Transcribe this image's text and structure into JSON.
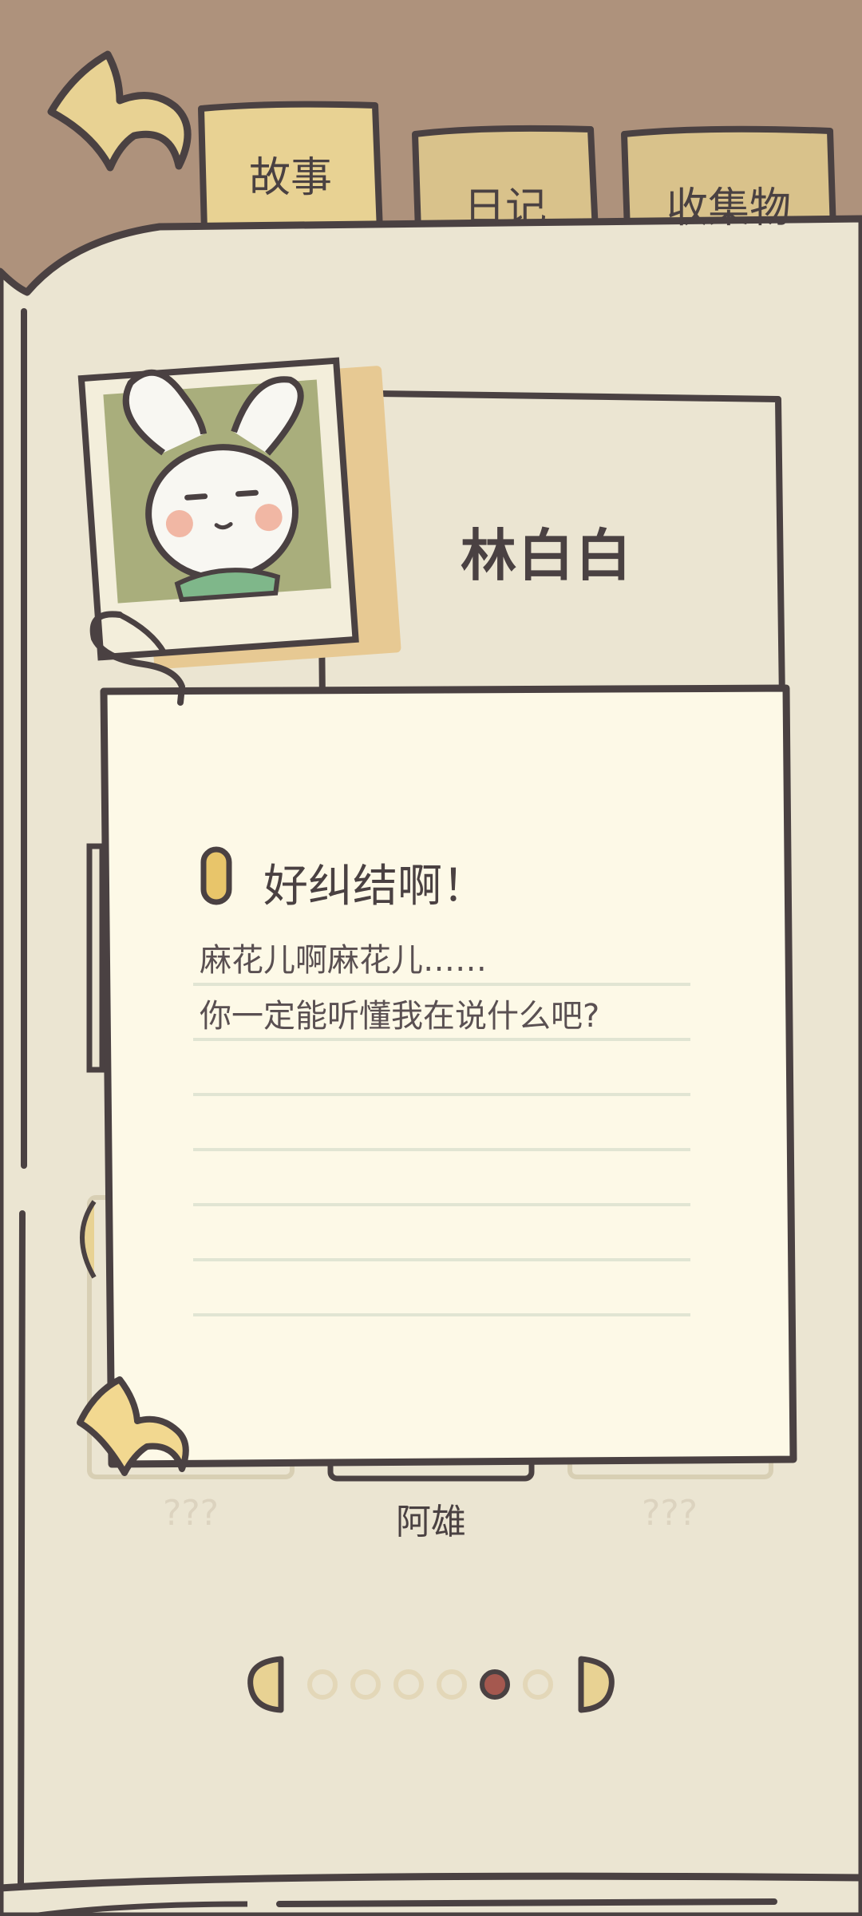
{
  "tabs": [
    {
      "label": "故事",
      "active": true
    },
    {
      "label": "日记",
      "active": false
    },
    {
      "label": "收集物",
      "active": false
    }
  ],
  "character": {
    "name": "林白白"
  },
  "note": {
    "title": "好纠结啊！",
    "lines": [
      "麻花儿啊麻花儿……",
      "你一定能听懂我在说什么吧?"
    ]
  },
  "cards": [
    {
      "label": "???",
      "locked": true
    },
    {
      "label": "阿雄",
      "locked": false
    },
    {
      "label": "???",
      "locked": true
    }
  ],
  "pagination": {
    "total": 6,
    "current": 5
  },
  "colors": {
    "background_top": "#ae927c",
    "book_page": "#ebe5d2",
    "note_paper": "#fdf9e7",
    "tab": "#e8d293",
    "outline": "#4a4142",
    "accent_dot": "#a5584f",
    "photo_bg": "#a9ae7c"
  }
}
